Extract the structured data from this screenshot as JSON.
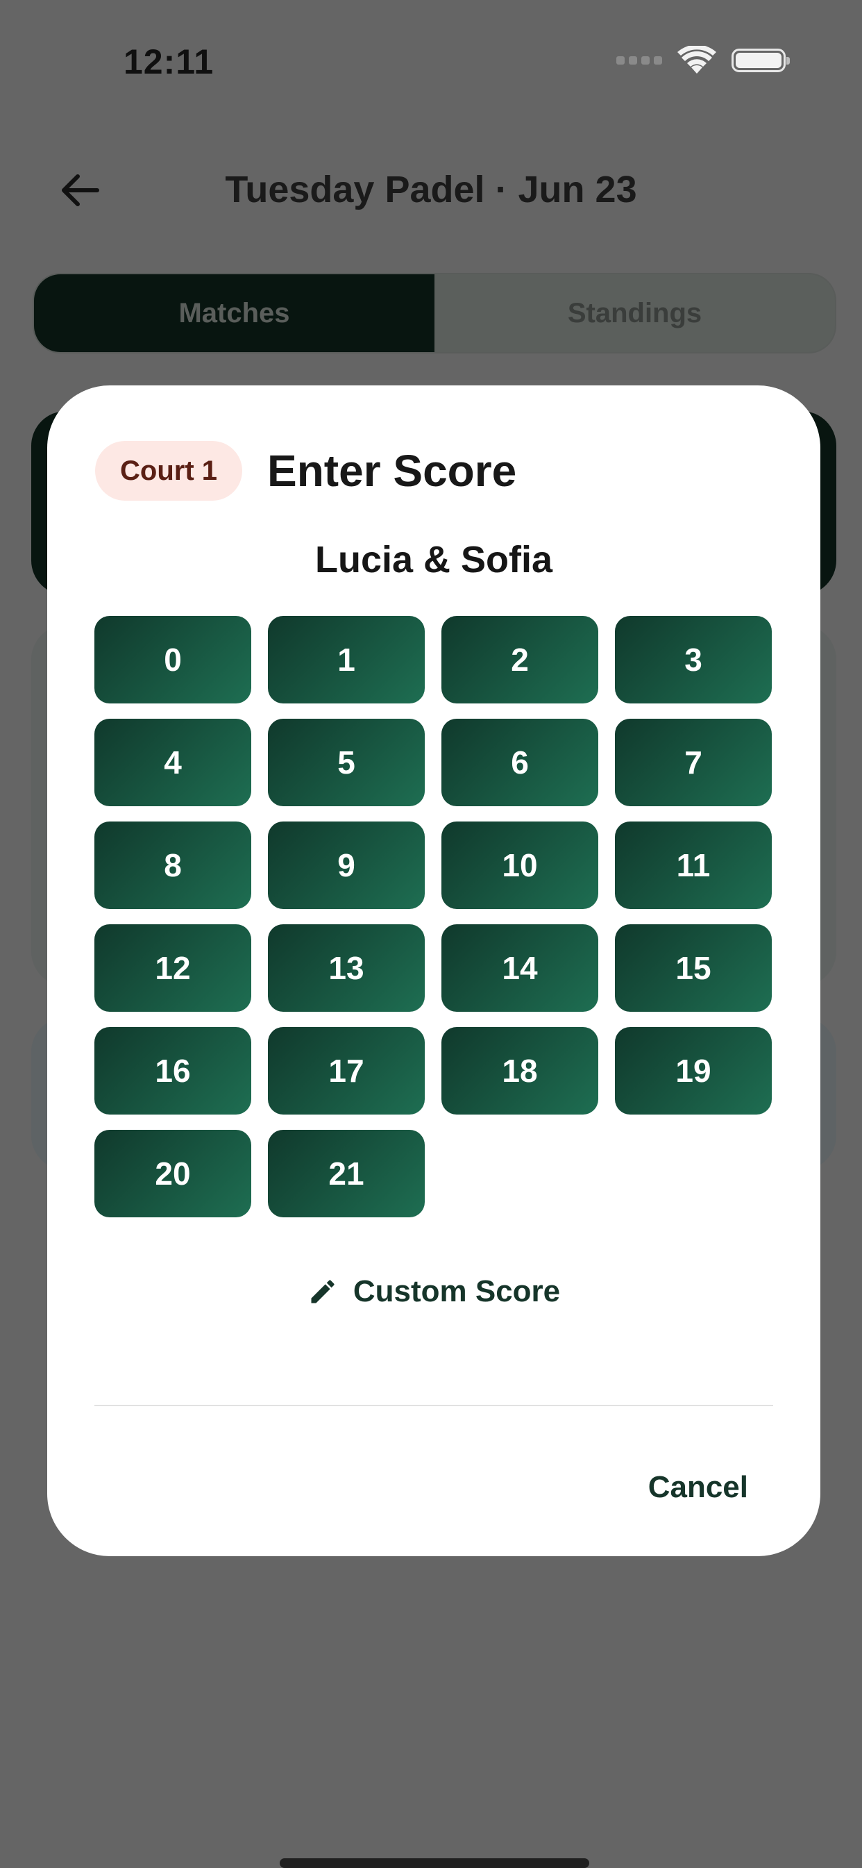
{
  "status_bar": {
    "time": "12:11"
  },
  "header": {
    "title": "Tuesday Padel · Jun 23"
  },
  "tabs": [
    {
      "label": "Matches",
      "active": true
    },
    {
      "label": "Standings",
      "active": false
    }
  ],
  "dialog": {
    "court_badge": "Court 1",
    "title": "Enter Score",
    "team": "Lucia & Sofia",
    "scores": [
      "0",
      "1",
      "2",
      "3",
      "4",
      "5",
      "6",
      "7",
      "8",
      "9",
      "10",
      "11",
      "12",
      "13",
      "14",
      "15",
      "16",
      "17",
      "18",
      "19",
      "20",
      "21"
    ],
    "custom_score_label": "Custom Score",
    "cancel_label": "Cancel"
  },
  "colors": {
    "accent_dark": "#10392c",
    "accent_light": "#1e6e52",
    "badge_bg": "#fde8e4",
    "badge_text": "#5a1f14"
  },
  "icons": [
    "back-arrow-icon",
    "wifi-icon",
    "battery-icon",
    "pencil-icon"
  ]
}
